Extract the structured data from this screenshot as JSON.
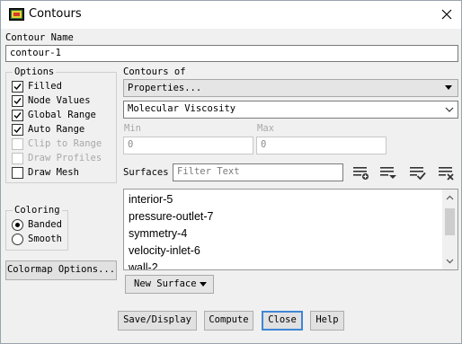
{
  "window": {
    "title": "Contours"
  },
  "contour_name": {
    "label": "Contour Name",
    "value": "contour-1"
  },
  "options": {
    "title": "Options",
    "items": [
      {
        "label": "Filled",
        "checked": true,
        "enabled": true
      },
      {
        "label": "Node Values",
        "checked": true,
        "enabled": true
      },
      {
        "label": "Global Range",
        "checked": true,
        "enabled": true
      },
      {
        "label": "Auto Range",
        "checked": true,
        "enabled": true
      },
      {
        "label": "Clip to Range",
        "checked": false,
        "enabled": false
      },
      {
        "label": "Draw Profiles",
        "checked": false,
        "enabled": false
      },
      {
        "label": "Draw Mesh",
        "checked": false,
        "enabled": true
      }
    ]
  },
  "coloring": {
    "title": "Coloring",
    "items": [
      {
        "label": "Banded",
        "selected": true
      },
      {
        "label": "Smooth",
        "selected": false
      }
    ]
  },
  "colormap_button": "Colormap Options...",
  "contours_of": {
    "label": "Contours of",
    "category": "Properties...",
    "quantity": "Molecular Viscosity"
  },
  "range": {
    "min_label": "Min",
    "min_value": "0",
    "max_label": "Max",
    "max_value": "0"
  },
  "surfaces": {
    "label": "Surfaces",
    "filter_placeholder": "Filter Text",
    "items": [
      "interior-5",
      "pressure-outlet-7",
      "symmetry-4",
      "velocity-inlet-6",
      "wall-2"
    ],
    "new_surface": "New Surface"
  },
  "buttons": {
    "save_display": "Save/Display",
    "compute": "Compute",
    "close": "Close",
    "help": "Help"
  }
}
